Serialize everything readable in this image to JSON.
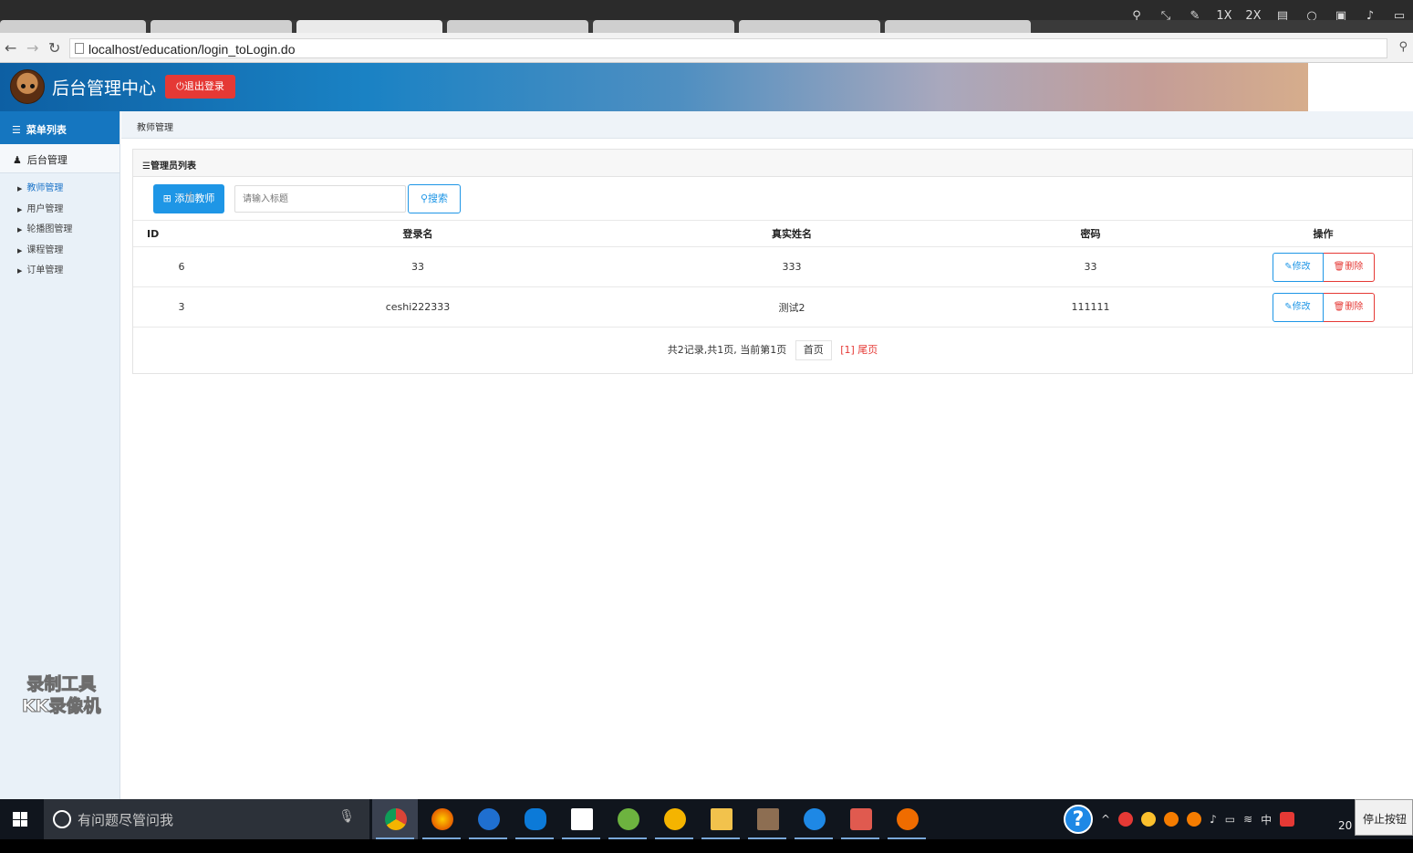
{
  "recorder_bar": {
    "buttons": [
      "1X",
      "2X"
    ]
  },
  "browser": {
    "url": "localhost/education/login_toLogin.do"
  },
  "header": {
    "title": "后台管理中心",
    "logout_label": "退出登录"
  },
  "sidebar": {
    "menu_title": "菜单列表",
    "group_label": "后台管理",
    "items": [
      {
        "label": "教师管理",
        "active": true
      },
      {
        "label": "用户管理",
        "active": false
      },
      {
        "label": "轮播图管理",
        "active": false
      },
      {
        "label": "课程管理",
        "active": false
      },
      {
        "label": "订单管理",
        "active": false
      }
    ]
  },
  "watermark": {
    "line1": "录制工具",
    "line2": "KK录像机"
  },
  "breadcrumb": "教师管理",
  "panel": {
    "title": "☰管理员列表",
    "add_button_label": "添加教师",
    "search_placeholder": "请输入标题",
    "search_button_label": "搜索"
  },
  "table": {
    "columns": [
      "ID",
      "登录名",
      "真实姓名",
      "密码",
      "操作"
    ],
    "rows": [
      {
        "id": "6",
        "login": "33",
        "name": "333",
        "password": "33",
        "edit": "修改",
        "delete": "删除"
      },
      {
        "id": "3",
        "login": "ceshi222333",
        "name": "测试2",
        "password": "111111",
        "edit": "修改",
        "delete": "删除"
      }
    ]
  },
  "pagination": {
    "summary": "共2记录,共1页, 当前第1页",
    "first": "首页",
    "current": "[1]",
    "last": "尾页"
  },
  "taskbar": {
    "search_placeholder": "有问题尽管问我",
    "ime": "中",
    "clock": "20",
    "stop_tip": "停止按钮"
  }
}
